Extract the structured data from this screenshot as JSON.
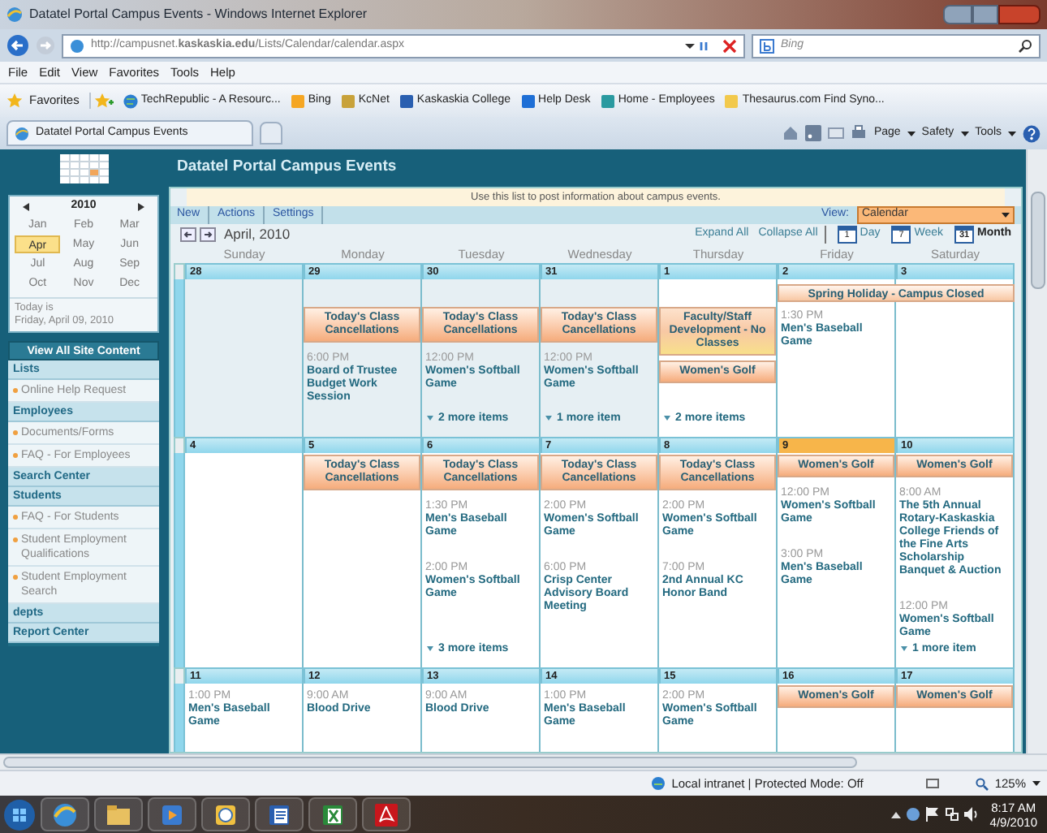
{
  "window": {
    "title": "Datatel Portal Campus Events - Windows Internet Explorer",
    "url": "http://campusnet.**kaskaskia.edu**/Lists/Calendar/calendar.aspx",
    "search_placeholder": "Bing",
    "menu": [
      "File",
      "Edit",
      "View",
      "Favorites",
      "Tools",
      "Help"
    ],
    "favorites_label": "Favorites",
    "favorites": [
      "TechRepublic - A Resourc...",
      "Bing",
      "KcNet",
      "Kaskaskia College",
      "Help Desk",
      "Home - Employees",
      "Thesaurus.com Find Syno..."
    ],
    "tab": "Datatel Portal Campus Events",
    "commands": [
      "Page",
      "Safety",
      "Tools"
    ],
    "status": "Local intranet | Protected Mode: Off",
    "zoom": "125%"
  },
  "site": {
    "title": "Datatel Portal Campus Events",
    "notice": "Use this list to post information about campus events.",
    "toolbar": [
      "New",
      "Actions",
      "Settings"
    ],
    "view_label": "View:",
    "view_value": "Calendar",
    "month_title": "April, 2010",
    "expand": "Expand All",
    "collapse": "Collapse All",
    "views": [
      {
        "label": "Day",
        "icon": "1",
        "selected": false
      },
      {
        "label": "Week",
        "icon": "7",
        "selected": false
      },
      {
        "label": "Month",
        "icon": "31",
        "selected": true
      }
    ]
  },
  "sidebar": {
    "year": "2010",
    "months": [
      {
        "label": "Jan",
        "selected": false
      },
      {
        "label": "Feb",
        "selected": false
      },
      {
        "label": "Mar",
        "selected": false
      },
      {
        "label": "Apr",
        "selected": true
      },
      {
        "label": "May",
        "selected": false
      },
      {
        "label": "Jun",
        "selected": false
      },
      {
        "label": "Jul",
        "selected": false
      },
      {
        "label": "Aug",
        "selected": false
      },
      {
        "label": "Sep",
        "selected": false
      },
      {
        "label": "Oct",
        "selected": false
      },
      {
        "label": "Nov",
        "selected": false
      },
      {
        "label": "Dec",
        "selected": false
      }
    ],
    "today_label": "Today is",
    "today_date": "Friday, April 09, 2010",
    "nav": [
      {
        "kind": "button",
        "label": "View All Site Content"
      },
      {
        "kind": "heading",
        "label": "Lists"
      },
      {
        "kind": "link",
        "label": "Online Help Request"
      },
      {
        "kind": "heading",
        "label": "Employees"
      },
      {
        "kind": "link",
        "label": "Documents/Forms"
      },
      {
        "kind": "link",
        "label": "FAQ - For Employees"
      },
      {
        "kind": "heading",
        "label": "Search Center"
      },
      {
        "kind": "heading",
        "label": "Students"
      },
      {
        "kind": "link",
        "label": "FAQ - For Students"
      },
      {
        "kind": "link",
        "label": "Student Employment Qualifications"
      },
      {
        "kind": "link",
        "label": "Student Employment Search"
      },
      {
        "kind": "heading",
        "label": "depts"
      },
      {
        "kind": "heading",
        "label": "Report Center"
      }
    ]
  },
  "calendar": {
    "weekdays": [
      "Sunday",
      "Monday",
      "Tuesday",
      "Wednesday",
      "Thursday",
      "Friday",
      "Saturday"
    ],
    "weeks": [
      {
        "days": [
          {
            "date": "28",
            "other_month": true,
            "today": false
          },
          {
            "date": "29",
            "other_month": true,
            "today": false,
            "events": [
              {
                "kind": "banner",
                "title": "Today's Class Cancellations"
              },
              {
                "kind": "timed",
                "time": "6:00 PM",
                "title": "Board of Trustee Budget Work Session"
              }
            ]
          },
          {
            "date": "30",
            "other_month": true,
            "today": false,
            "events": [
              {
                "kind": "banner",
                "title": "Today's Class Cancellations"
              },
              {
                "kind": "timed",
                "time": "12:00 PM",
                "title": "Women's Softball Game"
              },
              {
                "kind": "more",
                "title": "2 more items"
              }
            ]
          },
          {
            "date": "31",
            "other_month": true,
            "today": false,
            "events": [
              {
                "kind": "banner",
                "title": "Today's Class Cancellations"
              },
              {
                "kind": "timed",
                "time": "12:00 PM",
                "title": "Women's Softball Game"
              },
              {
                "kind": "more",
                "title": "1 more item"
              }
            ]
          },
          {
            "date": "1",
            "other_month": false,
            "today": false,
            "events": [
              {
                "kind": "notice",
                "title": "Faculty/Staff Development - No Classes"
              },
              {
                "kind": "banner",
                "title": "Women's Golf"
              },
              {
                "kind": "more",
                "title": "2 more items"
              }
            ]
          },
          {
            "date": "2",
            "other_month": false,
            "today": false,
            "span_banner": "Spring Holiday - Campus Closed",
            "events": [
              {
                "kind": "timed",
                "time": "1:30 PM",
                "title": "Men's Baseball Game"
              }
            ]
          },
          {
            "date": "3",
            "other_month": false,
            "today": false,
            "covered_by_span": true
          }
        ]
      },
      {
        "days": [
          {
            "date": "4",
            "other_month": false,
            "today": false
          },
          {
            "date": "5",
            "other_month": false,
            "today": false,
            "events": [
              {
                "kind": "banner",
                "title": "Today's Class Cancellations"
              }
            ]
          },
          {
            "date": "6",
            "other_month": false,
            "today": false,
            "events": [
              {
                "kind": "banner",
                "title": "Today's Class Cancellations"
              },
              {
                "kind": "timed",
                "time": "1:30 PM",
                "title": "Men's Baseball Game"
              },
              {
                "kind": "timed",
                "time": "2:00 PM",
                "title": "Women's Softball Game"
              },
              {
                "kind": "more",
                "title": "3 more items"
              }
            ]
          },
          {
            "date": "7",
            "other_month": false,
            "today": false,
            "events": [
              {
                "kind": "banner",
                "title": "Today's Class Cancellations"
              },
              {
                "kind": "timed",
                "time": "2:00 PM",
                "title": "Women's Softball Game"
              },
              {
                "kind": "timed",
                "time": "6:00 PM",
                "title": "Crisp Center Advisory Board Meeting"
              }
            ]
          },
          {
            "date": "8",
            "other_month": false,
            "today": false,
            "events": [
              {
                "kind": "banner",
                "title": "Today's Class Cancellations"
              },
              {
                "kind": "timed",
                "time": "2:00 PM",
                "title": "Women's Softball Game"
              },
              {
                "kind": "timed",
                "time": "7:00 PM",
                "title": "2nd Annual KC Honor Band"
              }
            ]
          },
          {
            "date": "9",
            "other_month": false,
            "today": true,
            "events": [
              {
                "kind": "banner",
                "title": "Women's Golf"
              },
              {
                "kind": "timed",
                "time": "12:00 PM",
                "title": "Women's Softball Game"
              },
              {
                "kind": "timed",
                "time": "3:00 PM",
                "title": "Men's Baseball Game"
              }
            ]
          },
          {
            "date": "10",
            "other_month": false,
            "today": false,
            "events": [
              {
                "kind": "banner",
                "title": "Women's Golf"
              },
              {
                "kind": "timed",
                "time": "8:00 AM",
                "title": "The 5th Annual Rotary-Kaskaskia College Friends of the Fine Arts Scholarship Banquet & Auction"
              },
              {
                "kind": "timed",
                "time": "12:00 PM",
                "title": "Women's Softball Game"
              },
              {
                "kind": "more",
                "title": "1 more item"
              }
            ]
          }
        ]
      },
      {
        "days": [
          {
            "date": "11",
            "other_month": false,
            "today": false,
            "events": [
              {
                "kind": "timed",
                "time": "1:00 PM",
                "title": "Men's Baseball Game"
              }
            ]
          },
          {
            "date": "12",
            "other_month": false,
            "today": false,
            "events": [
              {
                "kind": "timed",
                "time": "9:00 AM",
                "title": "Blood Drive"
              }
            ]
          },
          {
            "date": "13",
            "other_month": false,
            "today": false,
            "events": [
              {
                "kind": "timed",
                "time": "9:00 AM",
                "title": "Blood Drive"
              }
            ]
          },
          {
            "date": "14",
            "other_month": false,
            "today": false,
            "events": [
              {
                "kind": "timed",
                "time": "1:00 PM",
                "title": "Men's Baseball Game"
              }
            ]
          },
          {
            "date": "15",
            "other_month": false,
            "today": false,
            "events": [
              {
                "kind": "timed",
                "time": "2:00 PM",
                "title": "Women's Softball Game"
              }
            ]
          },
          {
            "date": "16",
            "other_month": false,
            "today": false,
            "events": [
              {
                "kind": "banner",
                "title": "Women's Golf"
              }
            ]
          },
          {
            "date": "17",
            "other_month": false,
            "today": false,
            "events": [
              {
                "kind": "banner",
                "title": "Women's Golf"
              }
            ]
          }
        ]
      }
    ]
  },
  "taskbar": {
    "time": "8:17 AM",
    "date": "4/9/2010"
  }
}
